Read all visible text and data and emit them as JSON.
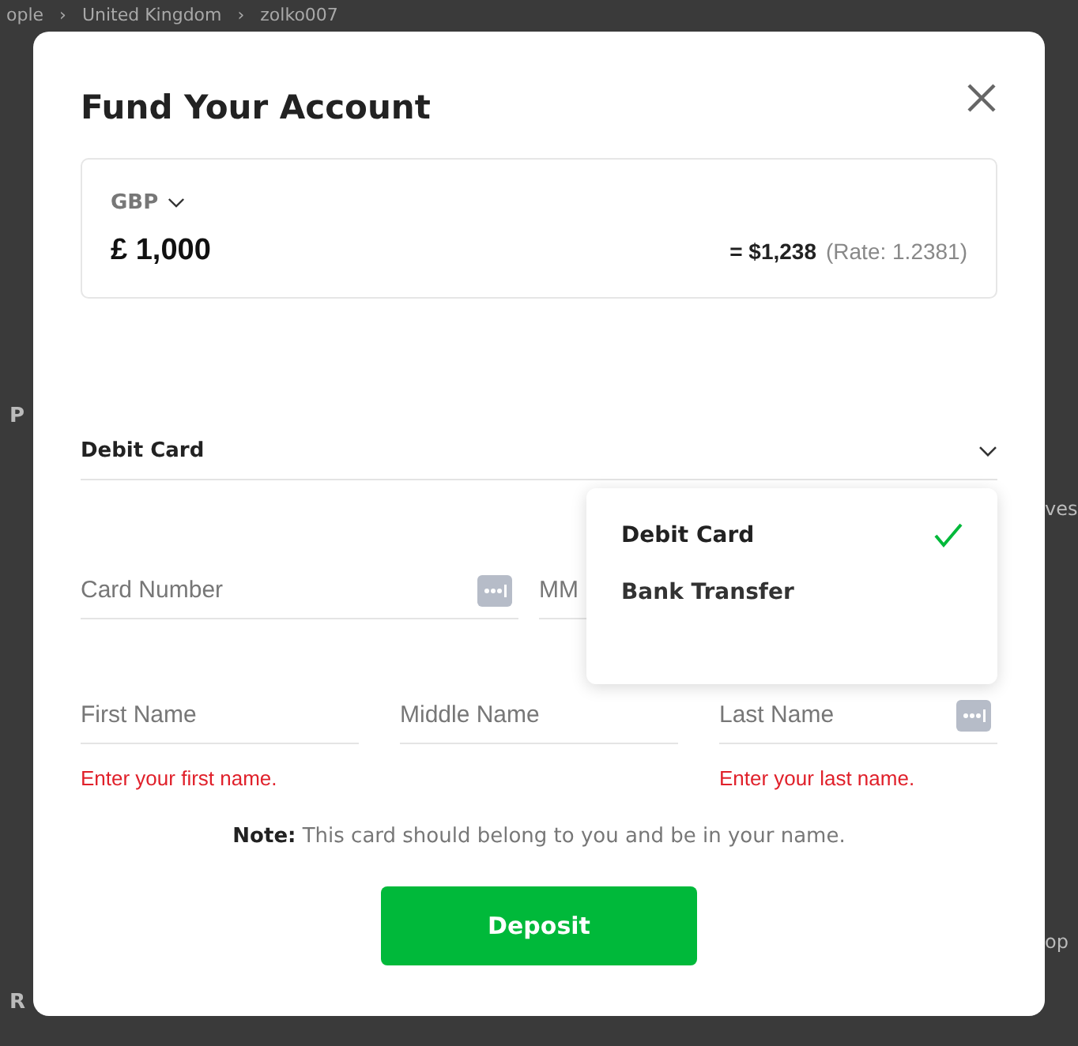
{
  "background": {
    "breadcrumbs": [
      "ople",
      "United Kingdom",
      "zolko007"
    ],
    "separator": "›",
    "fragments_left": [
      "P",
      "R"
    ],
    "fragments_right": [
      "ves",
      "op"
    ]
  },
  "modal": {
    "title": "Fund Your Account",
    "amount": {
      "currency": "GBP",
      "value": "£ 1,000",
      "converted": "= $1,238",
      "rate": "(Rate: 1.2381)"
    },
    "method": {
      "value": "Debit Card",
      "expanded": true,
      "options": [
        {
          "label": "Debit Card",
          "selected": true
        },
        {
          "label": "Bank Transfer",
          "selected": false
        }
      ]
    },
    "fields": [
      {
        "placeholder": "Card Number",
        "icon": true
      },
      {
        "placeholder": "MM"
      },
      {
        "placeholder": "First Name",
        "icon": false,
        "error": "Enter your first name."
      },
      {
        "placeholder": "Middle Name",
        "icon": false
      },
      {
        "placeholder": "Last Name",
        "icon": true,
        "error": "Enter your last name."
      }
    ],
    "note": "**Note:** This card should belong to you and be in your name.",
    "button": "Deposit"
  }
}
